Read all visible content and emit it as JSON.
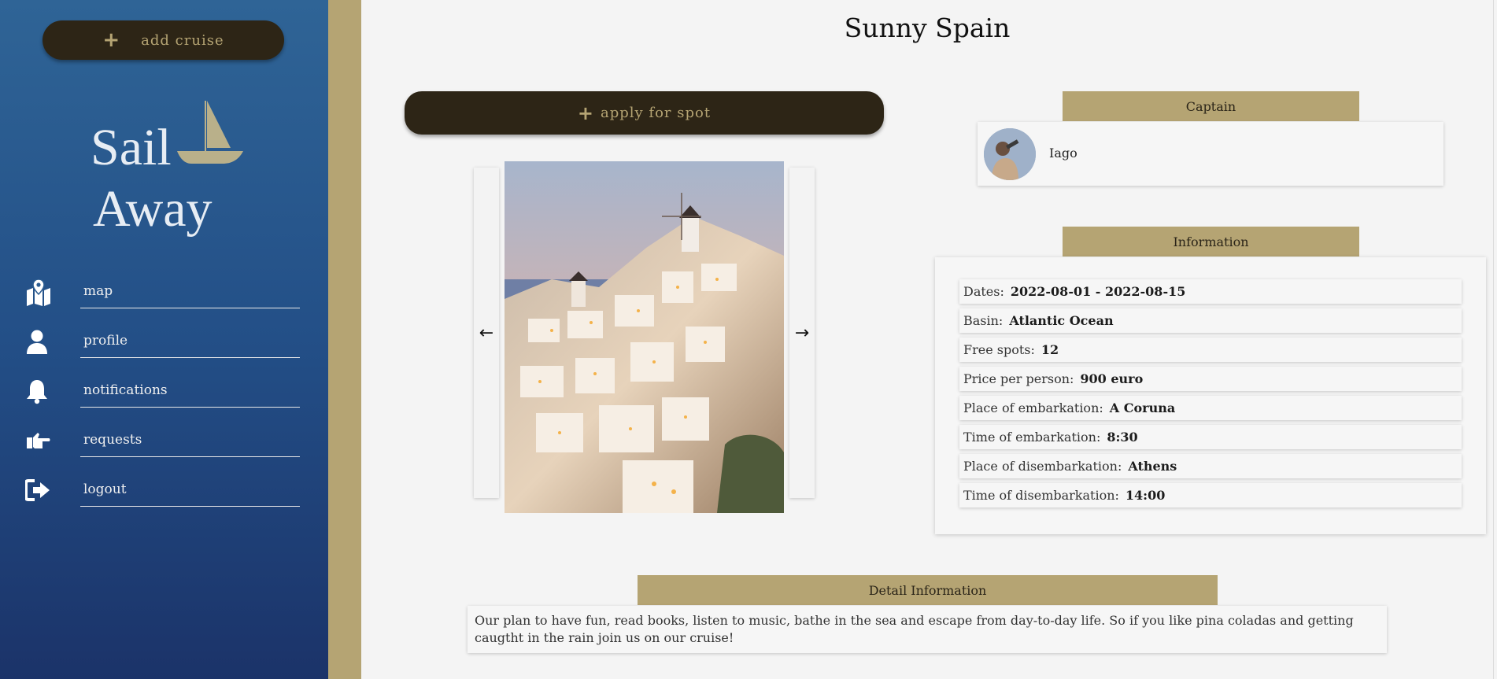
{
  "sidebar": {
    "add_cruise_label": "add cruise",
    "logo": {
      "line1": "Sail",
      "line2": "Away"
    },
    "items": [
      {
        "label": "map",
        "icon": "map-icon"
      },
      {
        "label": "profile",
        "icon": "user-icon"
      },
      {
        "label": "notifications",
        "icon": "bell-icon"
      },
      {
        "label": "requests",
        "icon": "hand-pointing-icon"
      },
      {
        "label": "logout",
        "icon": "logout-icon"
      }
    ]
  },
  "cruise": {
    "title": "Sunny Spain",
    "apply_label": "apply for spot",
    "captain_heading": "Captain",
    "captain_name": "Iago",
    "information_heading": "Information",
    "info": [
      {
        "label": "Dates:",
        "value": "2022-08-01 - 2022-08-15"
      },
      {
        "label": "Basin:",
        "value": "Atlantic Ocean"
      },
      {
        "label": "Free spots:",
        "value": "12"
      },
      {
        "label": "Price per person:",
        "value": "900 euro"
      },
      {
        "label": "Place of embarkation:",
        "value": "A Coruna"
      },
      {
        "label": "Time of embarkation:",
        "value": "8:30"
      },
      {
        "label": "Place of disembarkation:",
        "value": "Athens"
      },
      {
        "label": "Time of disembarkation:",
        "value": "14:00"
      }
    ],
    "detail_heading": "Detail Information",
    "detail_text": "Our plan to have fun, read books, listen to music, bathe in the sea and escape from day-to-day life. So if you like pina coladas and getting caugtht in the rain join us on our cruise!"
  },
  "colors": {
    "sidebar_top": "#2f6496",
    "sidebar_bottom": "#1b3369",
    "gold": "#b5a473",
    "dark_button": "#2d2516"
  }
}
